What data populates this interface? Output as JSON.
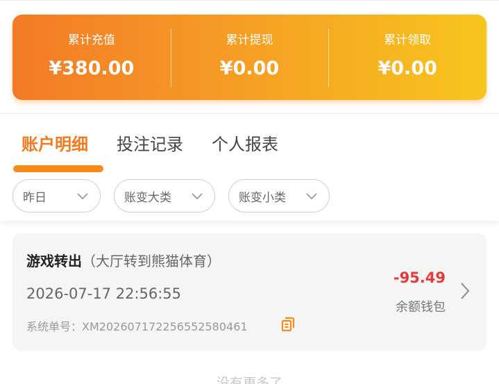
{
  "summary": {
    "recharge_label": "累计充值",
    "recharge_value": "¥380.00",
    "withdraw_label": "累计提现",
    "withdraw_value": "¥0.00",
    "claim_label": "累计领取",
    "claim_value": "¥0.00"
  },
  "tabs": [
    {
      "label": "账户明细",
      "active": true
    },
    {
      "label": "投注记录",
      "active": false
    },
    {
      "label": "个人报表",
      "active": false
    }
  ],
  "filters": {
    "date": "昨日",
    "category": "账变大类",
    "subcategory": "账变小类"
  },
  "record": {
    "type": "游戏转出",
    "detail": "（大厅转到熊猫体育）",
    "time": "2026-07-17 22:56:55",
    "order_label": "系统单号：",
    "order_no": "XM2026071722565525804​61",
    "amount": "-95.49",
    "wallet": "余额钱包"
  },
  "footer": {
    "no_more": "没有更多了"
  },
  "colors": {
    "accent": "#f78a18",
    "negative": "#e5393a"
  }
}
